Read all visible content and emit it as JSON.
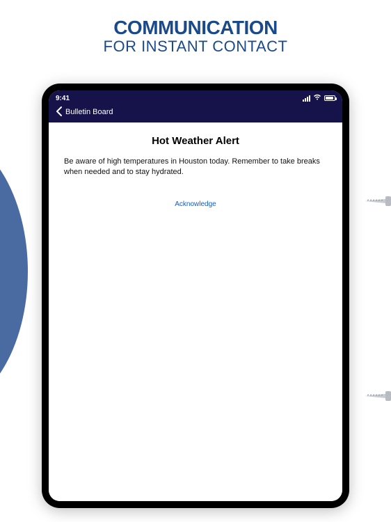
{
  "promo": {
    "line1": "COMMUNICATION",
    "line2": "FOR INSTANT CONTACT"
  },
  "statusbar": {
    "time": "9:41"
  },
  "nav": {
    "back_label": "Bulletin Board"
  },
  "alert": {
    "title": "Hot Weather Alert",
    "body": "Be aware of high temperatures in Houston today. Remember to take breaks when needed and to stay hydrated.",
    "acknowledge_label": "Acknowledge"
  }
}
